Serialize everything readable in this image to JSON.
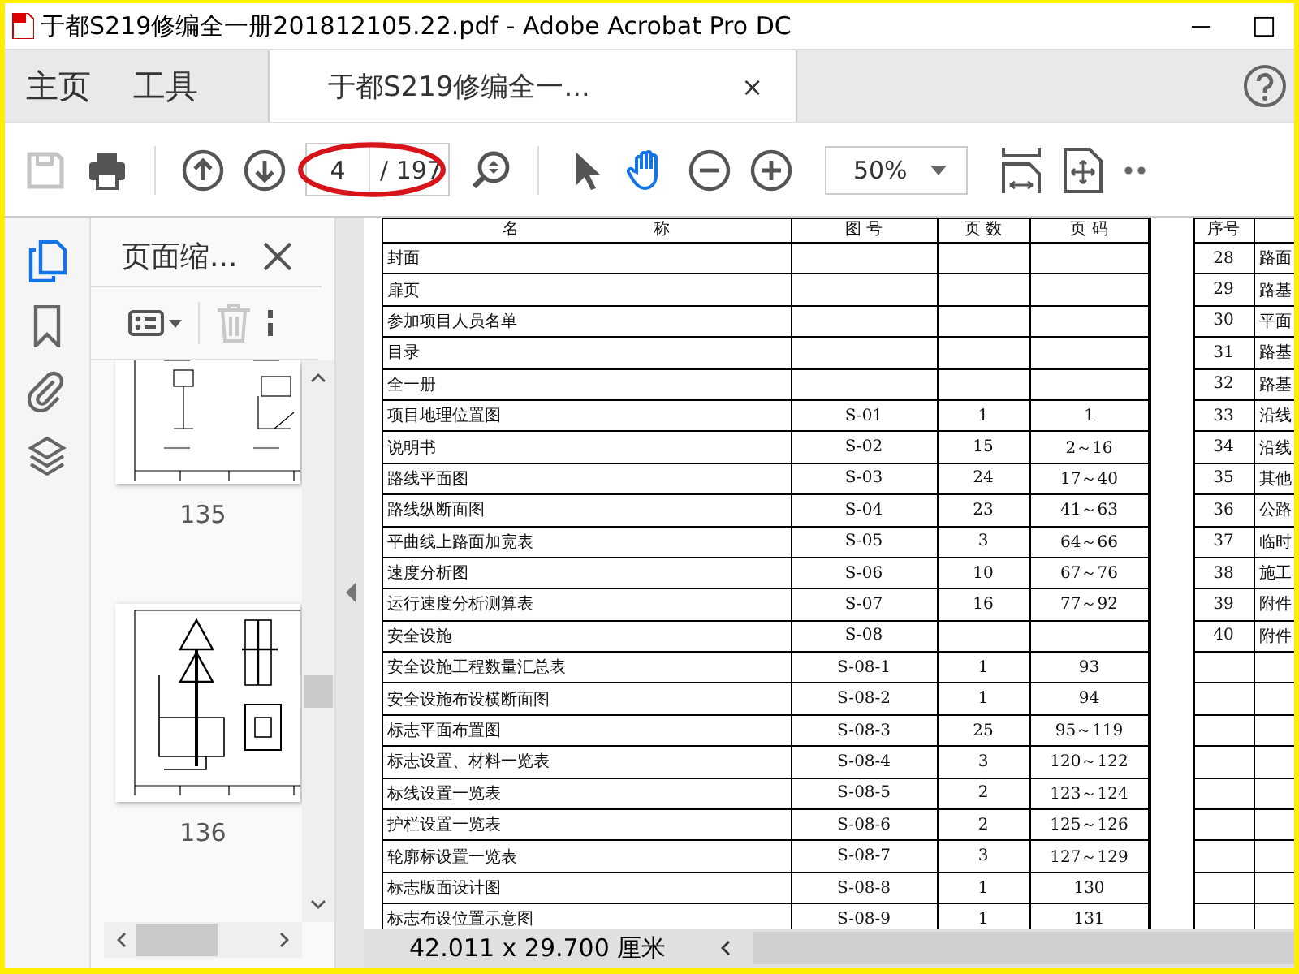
{
  "window": {
    "title": "于都S219修编全一册201812105.22.pdf - Adobe Acrobat Pro DC"
  },
  "menu_tabs": [
    {
      "label": "主页",
      "selected": false
    },
    {
      "label": "工具",
      "selected": false
    },
    {
      "label": "于都S219修编全一...",
      "selected": true,
      "close": "×"
    }
  ],
  "toolbar": {
    "save_disabled": true,
    "page": "4",
    "page_count": "/ 197",
    "zoom": "50%",
    "tools": [
      {
        "kind": "select",
        "selected": false
      },
      {
        "kind": "hand",
        "selected": true
      }
    ]
  },
  "rail": [
    {
      "kind": "pages",
      "selected": true
    },
    {
      "kind": "bookmarks",
      "selected": false
    },
    {
      "kind": "attachments",
      "selected": false
    },
    {
      "kind": "layers",
      "selected": false
    }
  ],
  "panel": {
    "title": "页面缩...",
    "delete_disabled": true,
    "thumbnails": [
      {
        "label": "135"
      },
      {
        "label": "136"
      }
    ]
  },
  "table": {
    "columns": [
      "名 称",
      "图 号",
      "页 数",
      "页 码"
    ],
    "right_columns": [
      "序号"
    ],
    "rows": [
      {
        "name": "封面"
      },
      {
        "name": "扉页"
      },
      {
        "name": "参加项目人员名单"
      },
      {
        "name": "目录"
      },
      {
        "name": "全一册"
      },
      {
        "name": "项目地理位置图",
        "drawing_no": "S-01",
        "sheets": "1",
        "pages": "1"
      },
      {
        "name": "说明书",
        "drawing_no": "S-02",
        "sheets": "15",
        "pages": "2～16"
      },
      {
        "name": "路线平面图",
        "drawing_no": "S-03",
        "sheets": "24",
        "pages": "17～40"
      },
      {
        "name": "路线纵断面图",
        "drawing_no": "S-04",
        "sheets": "23",
        "pages": "41～63"
      },
      {
        "name": "平曲线上路面加宽表",
        "drawing_no": "S-05",
        "sheets": "3",
        "pages": "64～66"
      },
      {
        "name": "速度分析图",
        "drawing_no": "S-06",
        "sheets": "10",
        "pages": "67～76"
      },
      {
        "name": "运行速度分析测算表",
        "drawing_no": "S-07",
        "sheets": "16",
        "pages": "77～92"
      },
      {
        "name": "安全设施",
        "drawing_no": "S-08"
      },
      {
        "name": "安全设施工程数量汇总表",
        "drawing_no": "S-08-1",
        "sheets": "1",
        "pages": "93"
      },
      {
        "name": "安全设施布设横断面图",
        "drawing_no": "S-08-2",
        "sheets": "1",
        "pages": "94"
      },
      {
        "name": "标志平面布置图",
        "drawing_no": "S-08-3",
        "sheets": "25",
        "pages": "95～119"
      },
      {
        "name": "标志设置、材料一览表",
        "drawing_no": "S-08-4",
        "sheets": "3",
        "pages": "120～122"
      },
      {
        "name": "标线设置一览表",
        "drawing_no": "S-08-5",
        "sheets": "2",
        "pages": "123～124"
      },
      {
        "name": "护栏设置一览表",
        "drawing_no": "S-08-6",
        "sheets": "2",
        "pages": "125～126"
      },
      {
        "name": "轮廓标设置一览表",
        "drawing_no": "S-08-7",
        "sheets": "3",
        "pages": "127～129"
      },
      {
        "name": "标志版面设计图",
        "drawing_no": "S-08-8",
        "sheets": "1",
        "pages": "130"
      },
      {
        "name": "标志布设位置示意图",
        "drawing_no": "S-08-9",
        "sheets": "1",
        "pages": "131"
      }
    ],
    "right_rows": [
      {
        "no": "28",
        "name": "路面"
      },
      {
        "no": "29",
        "name": "路基"
      },
      {
        "no": "30",
        "name": "平面"
      },
      {
        "no": "31",
        "name": "路基"
      },
      {
        "no": "32",
        "name": "路基"
      },
      {
        "no": "33",
        "name": "沿线"
      },
      {
        "no": "34",
        "name": "沿线"
      },
      {
        "no": "35",
        "name": "其他"
      },
      {
        "no": "36",
        "name": "公路"
      },
      {
        "no": "37",
        "name": "临时"
      },
      {
        "no": "38",
        "name": "施工"
      },
      {
        "no": "39",
        "name": "附件"
      },
      {
        "no": "40",
        "name": "附件"
      }
    ]
  },
  "status": {
    "page_size": "42.011 x 29.700 厘米"
  }
}
